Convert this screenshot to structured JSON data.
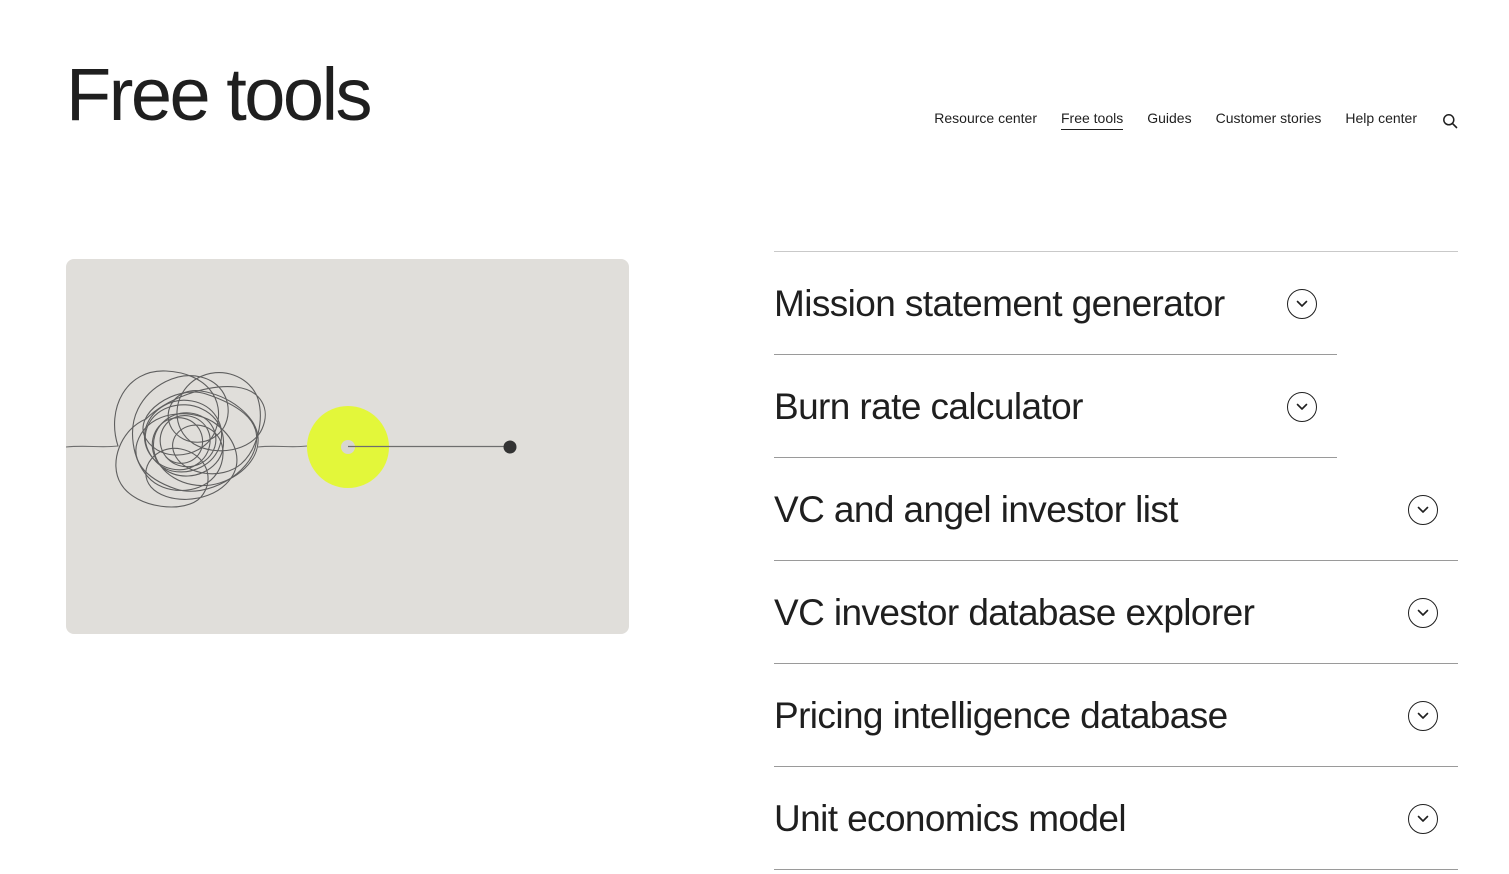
{
  "page": {
    "title": "Free tools"
  },
  "nav": {
    "items": [
      {
        "label": "Resource center",
        "active": false
      },
      {
        "label": "Free tools",
        "active": true
      },
      {
        "label": "Guides",
        "active": false
      },
      {
        "label": "Customer stories",
        "active": false
      },
      {
        "label": "Help center",
        "active": false
      }
    ],
    "search_icon": "search-icon"
  },
  "illustration": {
    "description_icon": "tangled-line-to-dot-illustration",
    "colors": {
      "background": "#e0deda",
      "accent": "#e3f73a",
      "line": "#6e6e6e",
      "dot": "#333333"
    }
  },
  "tools": {
    "items": [
      {
        "label": "Mission statement generator",
        "icon": "chevron-down-icon"
      },
      {
        "label": "Burn rate calculator",
        "icon": "chevron-down-icon"
      },
      {
        "label": "VC and angel investor list",
        "icon": "chevron-down-icon"
      },
      {
        "label": "VC investor database explorer",
        "icon": "chevron-down-icon"
      },
      {
        "label": "Pricing intelligence database",
        "icon": "chevron-down-icon"
      },
      {
        "label": "Unit economics model",
        "icon": "chevron-down-icon"
      }
    ]
  }
}
